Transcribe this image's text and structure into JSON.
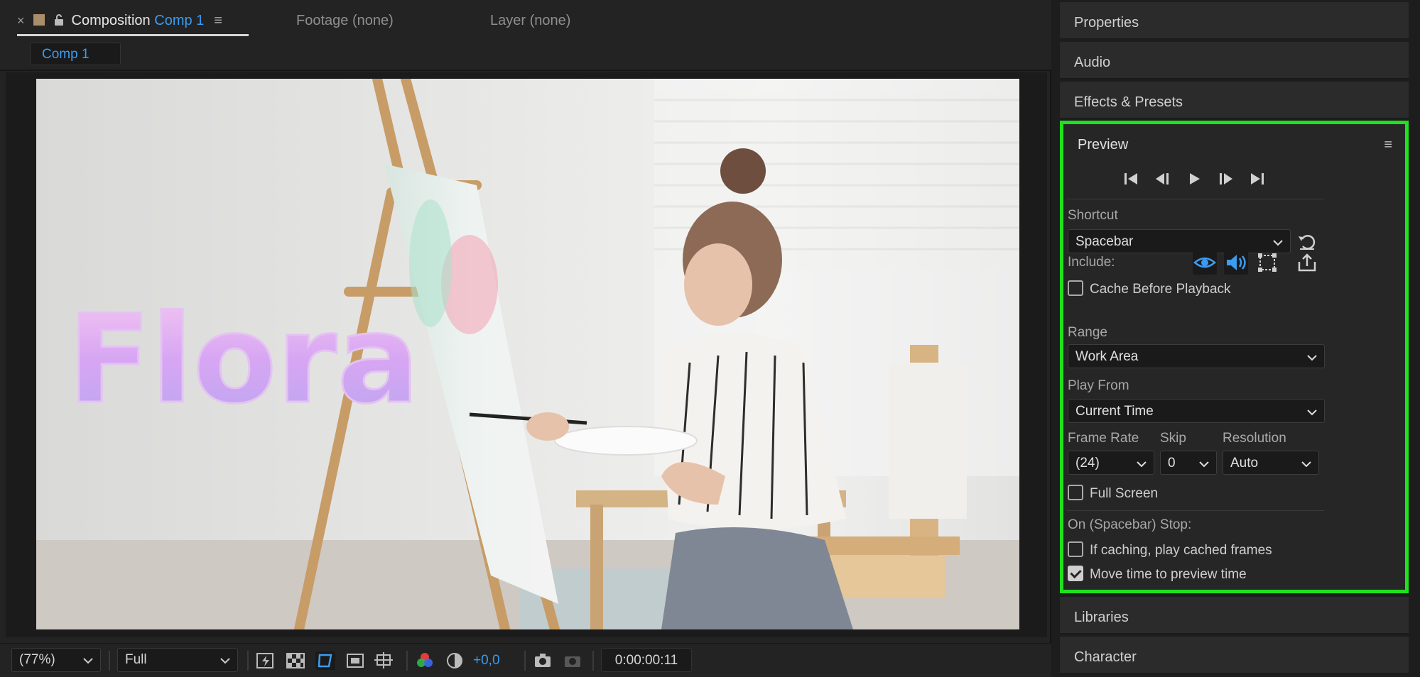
{
  "composition_panel": {
    "tab_prefix": "Composition",
    "tab_comp_name": "Comp 1",
    "footage_tab": "Footage (none)",
    "layer_tab": "Layer (none)",
    "comp_chip": "Comp 1",
    "viewer_text": "Flora"
  },
  "bottom_bar": {
    "zoom": "(77%)",
    "resolution": "Full",
    "exposure": "+0,0",
    "timecode": "0:00:00:11"
  },
  "right_panels": {
    "properties": "Properties",
    "audio": "Audio",
    "effects_presets": "Effects & Presets",
    "libraries": "Libraries",
    "character": "Character"
  },
  "preview": {
    "title": "Preview",
    "shortcut_label": "Shortcut",
    "shortcut_value": "Spacebar",
    "include_label": "Include:",
    "cache_before_playback": "Cache Before Playback",
    "cache_before_playback_checked": false,
    "range_label": "Range",
    "range_value": "Work Area",
    "play_from_label": "Play From",
    "play_from_value": "Current Time",
    "frame_rate_label": "Frame Rate",
    "frame_rate_value": "(24)",
    "skip_label": "Skip",
    "skip_value": "0",
    "resolution_label": "Resolution",
    "resolution_value": "Auto",
    "full_screen": "Full Screen",
    "full_screen_checked": false,
    "on_stop_label": "On (Spacebar) Stop:",
    "if_caching": "If caching, play cached frames",
    "if_caching_checked": false,
    "move_time": "Move time to preview time",
    "move_time_checked": true
  },
  "colors": {
    "accent_blue": "#3b9cf0",
    "highlight_green": "#1fe11f",
    "panel_bg": "#262626"
  }
}
